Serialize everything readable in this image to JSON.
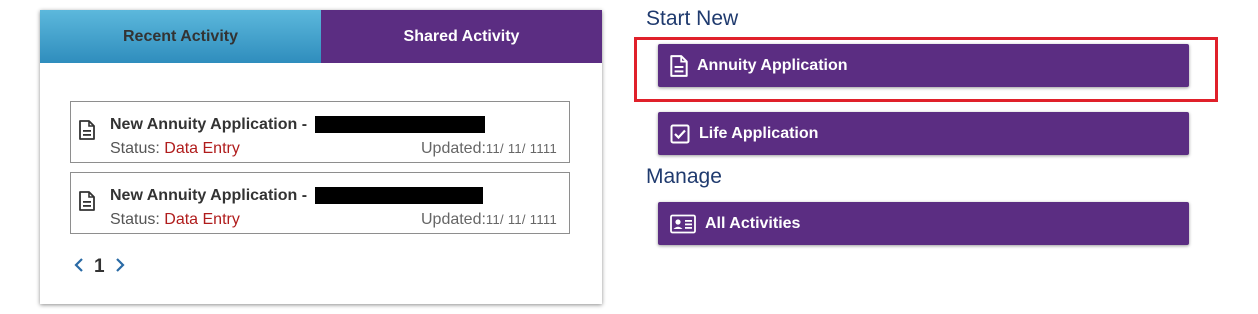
{
  "tabs": {
    "recent_label": "Recent Activity",
    "shared_label": "Shared Activity"
  },
  "activities": [
    {
      "title": "New Annuity Application -",
      "status_label": "Status:",
      "status_value": "Data Entry",
      "updated_label": "Updated:",
      "updated_date": "11/ 11/ 1111"
    },
    {
      "title": "New Annuity Application -",
      "status_label": "Status:",
      "status_value": "Data Entry",
      "updated_label": "Updated:",
      "updated_date": "11/ 11/ 1111"
    }
  ],
  "pagination": {
    "current_page": "1",
    "prev_icon": "chevron-left-icon",
    "next_icon": "chevron-right-icon"
  },
  "start_new": {
    "heading": "Start New",
    "annuity_label": "Annuity Application",
    "annuity_icon": "document-icon",
    "life_label": "Life Application",
    "life_icon": "checkbox-icon"
  },
  "manage": {
    "heading": "Manage",
    "all_label": "All Activities",
    "all_icon": "id-card-icon"
  },
  "colors": {
    "brand_purple": "#5b2d82",
    "tab_blue": "#3a9ccb",
    "status_red": "#b01c1c",
    "heading_navy": "#1f3a6e",
    "highlight_red": "#e0202a"
  }
}
